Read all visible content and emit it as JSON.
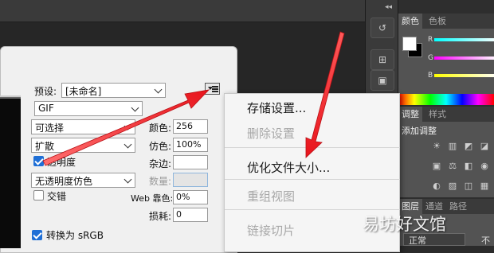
{
  "dialog": {
    "preset_label": "预设:",
    "preset_value": "[未命名]",
    "format_value": "GIF",
    "reduction_value": "可选择",
    "dither_algo_value": "扩散",
    "transparency_label": "透明度",
    "matte_dither_value": "无透明度仿色",
    "interlaced_label": "交错",
    "colors_label": "颜色:",
    "colors_value": "256",
    "dither_label": "仿色:",
    "dither_value": "100%",
    "matte_label": "杂边:",
    "amount_label": "数量:",
    "websnap_label": "Web 靠色:",
    "websnap_value": "0%",
    "lossy_label": "损耗:",
    "lossy_value": "0",
    "convert_label": "转换为 sRGB"
  },
  "context_menu": {
    "items": [
      {
        "label": "存储设置...",
        "disabled": false
      },
      {
        "label": "删除设置",
        "disabled": true
      },
      {
        "label": "优化文件大小...",
        "disabled": false
      },
      {
        "label": "重组视图",
        "disabled": true
      },
      {
        "label": "链接切片",
        "disabled": true
      }
    ]
  },
  "right_panels": {
    "collapse_glyph": "◂◂",
    "color_tabs": [
      "颜色",
      "色板"
    ],
    "channels": [
      "R",
      "G",
      "B"
    ],
    "adjust_tabs": [
      "调整",
      "样式"
    ],
    "adjust_title": "添加调整",
    "layers_tabs": [
      "图层",
      "通道",
      "路径"
    ],
    "blend_mode": "正常",
    "opacity_partial": "不"
  },
  "watermark": "易坊好文馆",
  "colors": {
    "accent_blue": "#1f6fd6",
    "arrow_red": "#e8141c",
    "panel_gray": "#535353"
  }
}
